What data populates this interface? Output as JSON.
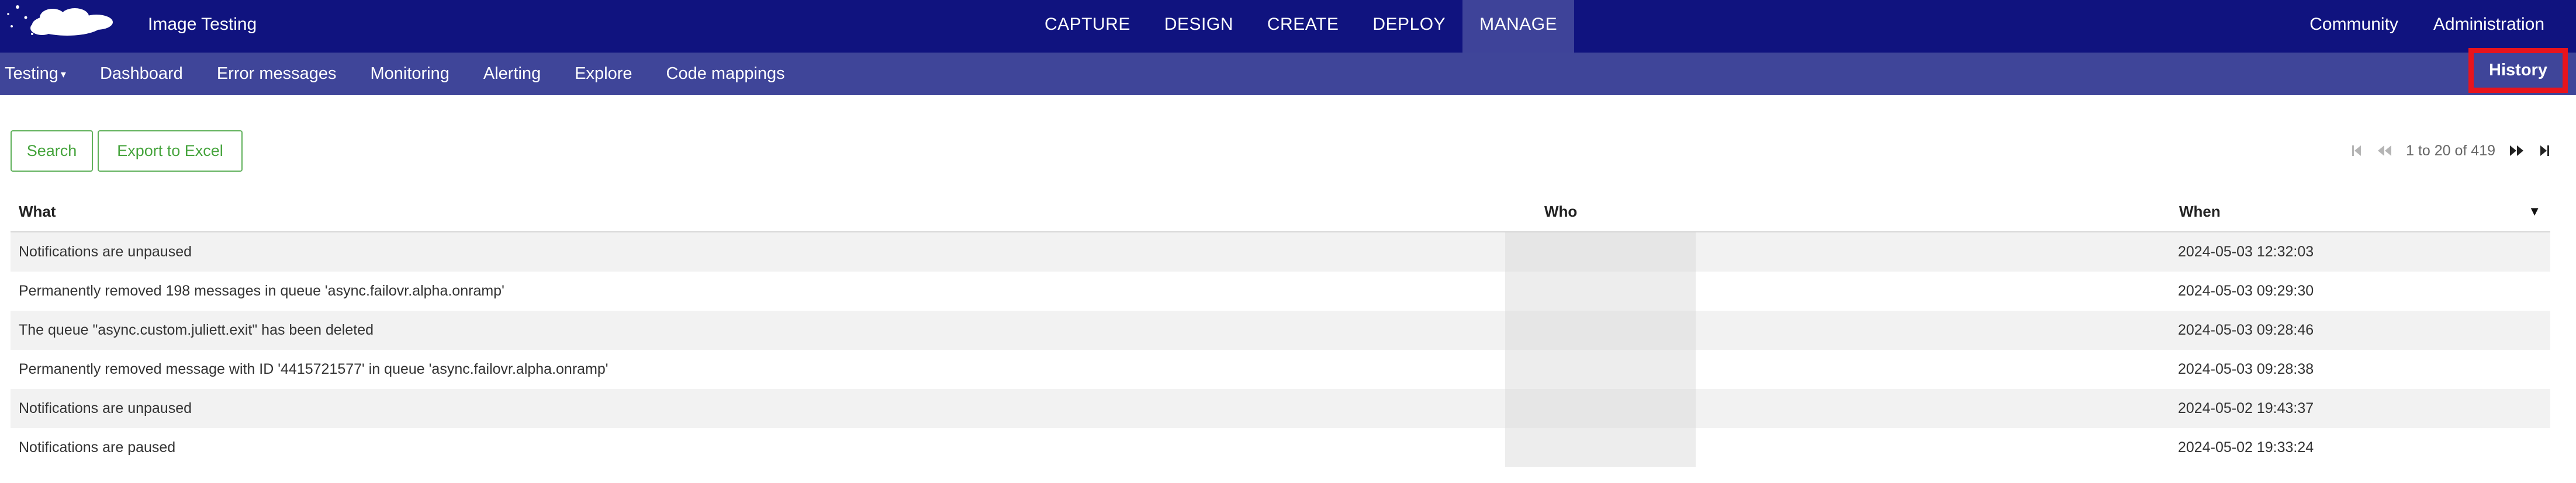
{
  "header": {
    "app_title": "Image Testing",
    "nav": [
      "CAPTURE",
      "DESIGN",
      "CREATE",
      "DEPLOY",
      "MANAGE"
    ],
    "active_nav": "MANAGE",
    "right_links": [
      "Community",
      "Administration"
    ]
  },
  "subnav": {
    "items": [
      "Testing",
      "Dashboard",
      "Error messages",
      "Monitoring",
      "Alerting",
      "Explore",
      "Code mappings"
    ],
    "history_label": "History"
  },
  "toolbar": {
    "search_label": "Search",
    "export_label": "Export to Excel"
  },
  "pager": {
    "range_text": "1 to 20 of 419"
  },
  "table": {
    "columns": [
      "What",
      "Who",
      "When"
    ],
    "rows": [
      {
        "what": "Notifications are unpaused",
        "who": "",
        "when": "2024-05-03 12:32:03"
      },
      {
        "what": "Permanently removed 198 messages in queue 'async.failovr.alpha.onramp'",
        "who": "",
        "when": "2024-05-03 09:29:30"
      },
      {
        "what": "The queue \"async.custom.juliett.exit\" has been deleted",
        "who": "",
        "when": "2024-05-03 09:28:46"
      },
      {
        "what": "Permanently removed message with ID '4415721577' in queue 'async.failovr.alpha.onramp'",
        "who": "",
        "when": "2024-05-03 09:28:38"
      },
      {
        "what": "Notifications are unpaused",
        "who": "",
        "when": "2024-05-02 19:43:37"
      },
      {
        "what": "Notifications are paused",
        "who": "",
        "when": "2024-05-02 19:33:24"
      }
    ]
  },
  "icons": {
    "logo": "cloud-logo",
    "first_page": "first-page-icon",
    "prev_page": "prev-page-icon",
    "next_page": "next-page-icon",
    "last_page": "last-page-icon",
    "sort": "sort-desc-icon"
  },
  "colors": {
    "topbar": "#10137f",
    "subnav": "#3f4599",
    "active_tab": "#3e4399",
    "highlight_border": "#e8141c",
    "button_green": "#46a43d"
  }
}
